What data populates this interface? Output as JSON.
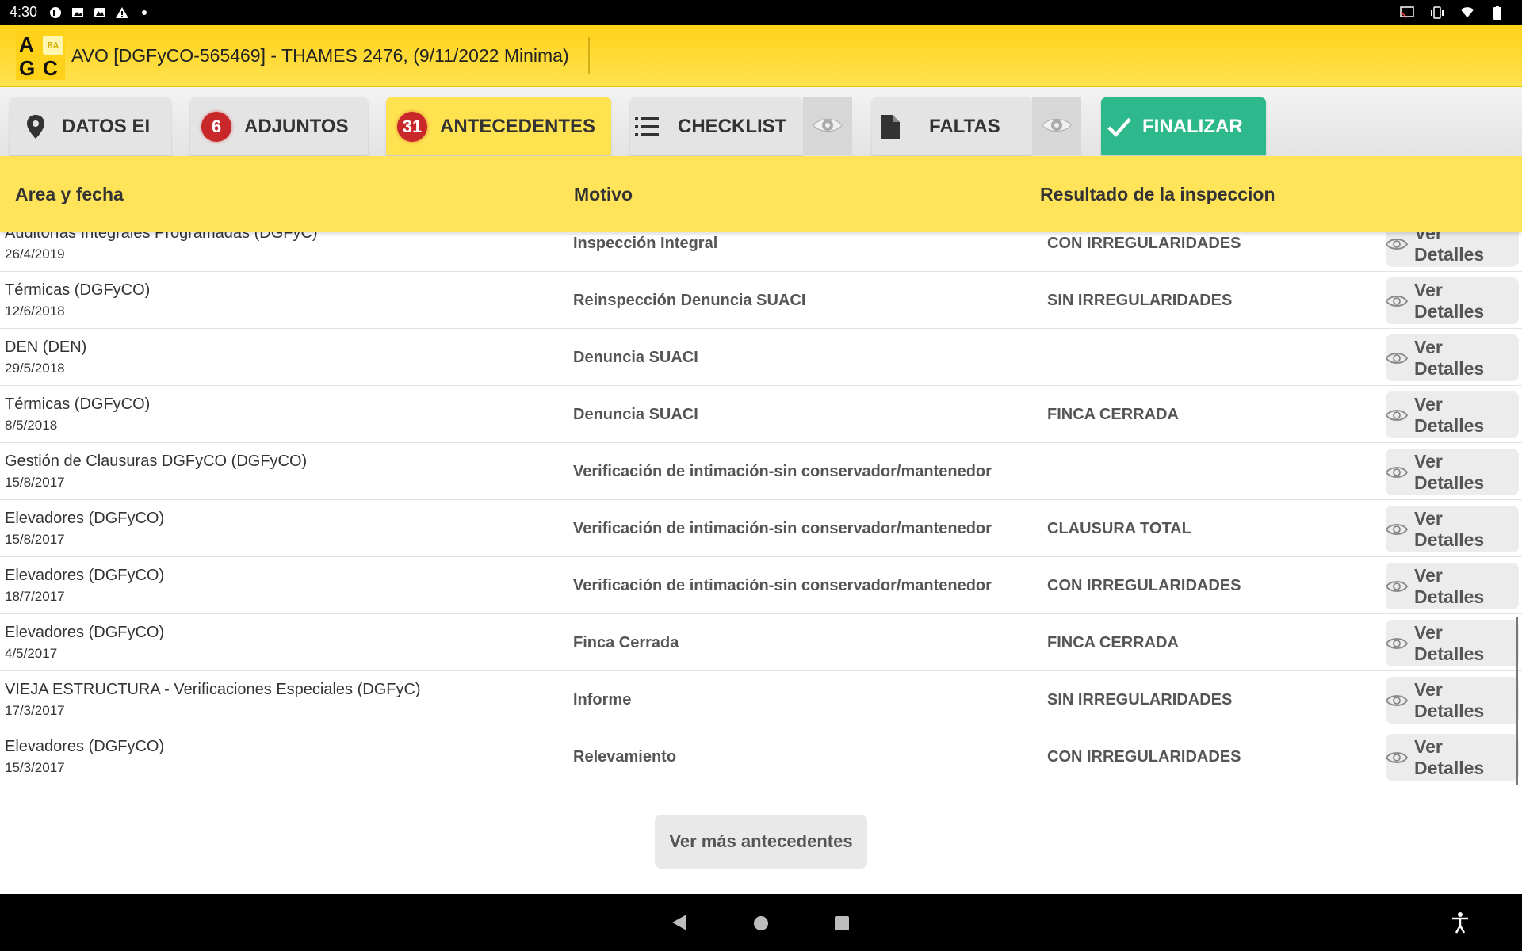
{
  "status_bar": {
    "time": "4:30"
  },
  "app": {
    "title": "AVO [DGFyCO-565469] - THAMES 2476, (9/11/2022 Minima)",
    "logo_letters": [
      "A",
      "G",
      "C"
    ],
    "logo_ba": "BA"
  },
  "tabs": {
    "datos": {
      "label": "DATOS EI",
      "icon": "location-pin-icon"
    },
    "adjuntos": {
      "label": "ADJUNTOS",
      "badge": "6"
    },
    "antecedentes": {
      "label": "ANTECEDENTES",
      "badge": "31"
    },
    "checklist": {
      "label": "CHECKLIST",
      "icon": "list-icon"
    },
    "faltas": {
      "label": "FALTAS",
      "icon": "document-icon"
    },
    "finalizar": {
      "label": "FINALIZAR",
      "icon": "check-icon"
    }
  },
  "table": {
    "headers": [
      "Area y fecha",
      "Motivo",
      "Resultado de la inspeccion"
    ],
    "button_label": "Ver Detalles",
    "rows": [
      {
        "area": "Auditorías Integrales Programadas (DGFyC)",
        "date": "26/4/2019",
        "motivo": "Inspección Integral",
        "resultado": "CON IRREGULARIDADES"
      },
      {
        "area": "Térmicas (DGFyCO)",
        "date": "12/6/2018",
        "motivo": "Reinspección Denuncia SUACI",
        "resultado": "SIN IRREGULARIDADES"
      },
      {
        "area": "DEN (DEN)",
        "date": "29/5/2018",
        "motivo": "Denuncia SUACI",
        "resultado": ""
      },
      {
        "area": "Térmicas (DGFyCO)",
        "date": "8/5/2018",
        "motivo": "Denuncia SUACI",
        "resultado": "FINCA CERRADA"
      },
      {
        "area": "Gestión de Clausuras DGFyCO (DGFyCO)",
        "date": "15/8/2017",
        "motivo": "Verificación de intimación-sin conservador/mantenedor",
        "resultado": ""
      },
      {
        "area": "Elevadores (DGFyCO)",
        "date": "15/8/2017",
        "motivo": "Verificación de intimación-sin conservador/mantenedor",
        "resultado": "CLAUSURA TOTAL"
      },
      {
        "area": "Elevadores (DGFyCO)",
        "date": "18/7/2017",
        "motivo": "Verificación de intimación-sin conservador/mantenedor",
        "resultado": "CON IRREGULARIDADES"
      },
      {
        "area": "Elevadores (DGFyCO)",
        "date": "4/5/2017",
        "motivo": "Finca Cerrada",
        "resultado": "FINCA CERRADA"
      },
      {
        "area": "VIEJA ESTRUCTURA - Verificaciones Especiales (DGFyC)",
        "date": "17/3/2017",
        "motivo": "Informe",
        "resultado": "SIN IRREGULARIDADES"
      },
      {
        "area": "Elevadores (DGFyCO)",
        "date": "15/3/2017",
        "motivo": "Relevamiento",
        "resultado": "CON IRREGULARIDADES"
      }
    ]
  },
  "more_button": "Ver más antecedentes",
  "colors": {
    "header_yellow": "#ffd21a",
    "active_tab": "#ffe24f",
    "finalizar_green": "#2eb98c",
    "badge_red": "#c8282a"
  }
}
